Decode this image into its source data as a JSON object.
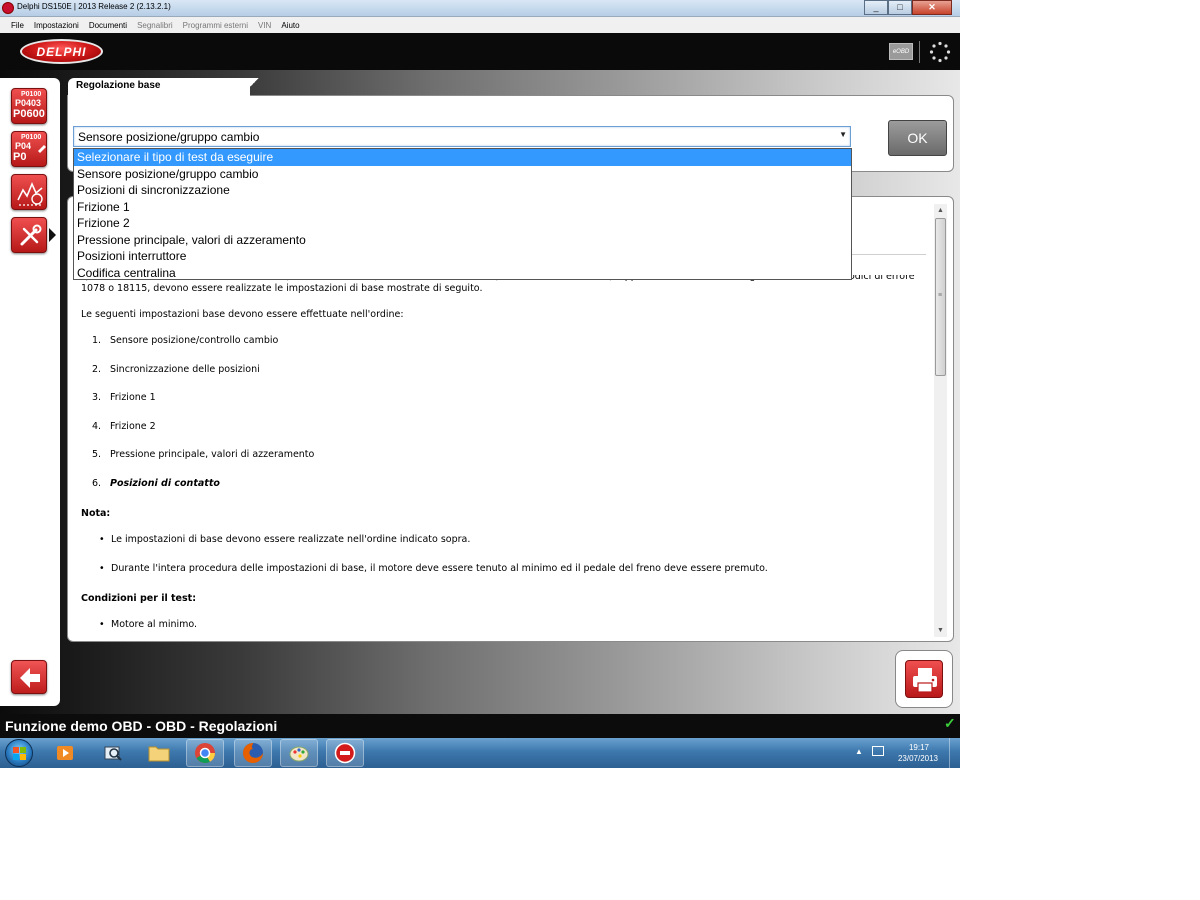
{
  "window": {
    "title": "Delphi DS150E | 2013 Release 2 (2.13.2.1)",
    "controls": {
      "minimize": "_",
      "maximize": "□",
      "close": "✕"
    }
  },
  "menu": {
    "items": [
      {
        "label": "File",
        "enabled": true
      },
      {
        "label": "Impostazioni",
        "enabled": true
      },
      {
        "label": "Documenti",
        "enabled": true
      },
      {
        "label": "Segnalibri",
        "enabled": false
      },
      {
        "label": "Programmi esterni",
        "enabled": false
      },
      {
        "label": "VIN",
        "enabled": false
      },
      {
        "label": "Aiuto",
        "enabled": true
      }
    ]
  },
  "brand": {
    "logo_text": "DELPHI",
    "eobd_label": "eOBD",
    "accent_color": "#d31b1b"
  },
  "sidebar": {
    "buttons": [
      {
        "name": "read-dtc",
        "codes": [
          "P0100",
          "P0403",
          "P0600"
        ]
      },
      {
        "name": "clear-dtc",
        "codes": [
          "P0100",
          "P04",
          "P0"
        ]
      },
      {
        "name": "live-data",
        "icon": "gauge-chart-icon"
      },
      {
        "name": "functions",
        "icon": "tools-icon"
      }
    ],
    "back_icon": "arrow-left-icon"
  },
  "top_panel": {
    "title": "Regolazione base",
    "select": {
      "value": "Sensore posizione/gruppo cambio",
      "options": [
        "Selezionare il tipo di test da eseguire",
        "Sensore posizione/gruppo cambio",
        "Posizioni di sincronizzazione",
        "Frizione 1",
        "Frizione 2",
        "Pressione principale, valori di azzeramento",
        "Posizioni interruttore",
        "Codifica centralina"
      ],
      "highlighted_index": 0
    },
    "ok_label": "OK"
  },
  "content": {
    "intro": "Quando viene sostituita l'unità del cambio (unità Mechatronic) della trasmissione DSG (Cambio a innesti diretti), oppure nella centralina vengono memorizzati i codici di errore 1078 o 18115, devono essere realizzate le impostazioni di base mostrate di seguito.",
    "order_intro": "Le seguenti impostazioni base devono essere effettuate nell'ordine:",
    "steps": [
      {
        "num": "1.",
        "text": "Sensore posizione/controllo cambio"
      },
      {
        "num": "2.",
        "text": "Sincronizzazione delle posizioni"
      },
      {
        "num": "3.",
        "text": "Frizione 1"
      },
      {
        "num": "4.",
        "text": "Frizione 2"
      },
      {
        "num": "5.",
        "text": "Pressione principale, valori di azzeramento"
      },
      {
        "num": "6.",
        "text": "Posizioni di contatto"
      }
    ],
    "note_heading": "Nota:",
    "notes": [
      "Le impostazioni di base devono essere realizzate nell'ordine indicato sopra.",
      "Durante l'intera procedura delle impostazioni di base, il motore deve essere tenuto al minimo ed il pedale del freno deve essere premuto."
    ],
    "conditions_heading": "Condizioni per il test:",
    "conditions": [
      "Motore al minimo."
    ]
  },
  "status": {
    "text": "Funzione demo OBD - OBD - Regolazioni",
    "ok_color": "#3ccf3c"
  },
  "taskbar": {
    "apps": [
      "media-player-icon",
      "magnifier-icon",
      "folder-icon",
      "chrome-icon",
      "firefox-icon",
      "paint-icon",
      "delphi-app-icon"
    ],
    "time": "19:17",
    "date": "23/07/2013"
  }
}
